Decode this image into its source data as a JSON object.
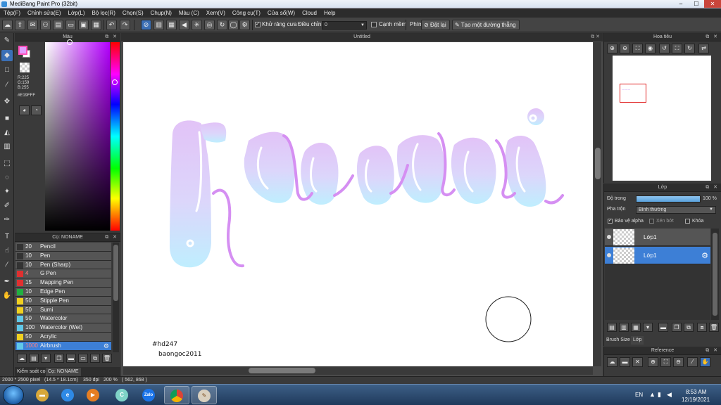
{
  "window": {
    "title": "MediBang Paint Pro (32bit)",
    "min": "–",
    "max": "☐",
    "close": "✕"
  },
  "menu": [
    "Tệp(F)",
    "Chỉnh sửa(E)",
    "Lớp(L)",
    "Bộ lọc(R)",
    "Chọn(S)",
    "Chụp(N)",
    "Màu (C)",
    "Xem(V)",
    "Công cụ(T)",
    "Cửa sổ(W)",
    "Cloud",
    "Help"
  ],
  "toolbar": {
    "antialias_label": "Khử răng cưa",
    "antialias_checked": true,
    "correction_label": "Điều chỉnh",
    "correction_value": "0",
    "edge_label": "Cạnh mềm",
    "edge_checked": false,
    "key_label": "Phím",
    "reset_label": "Đặt lại",
    "straight_line_label": "Tạo một đường thẳng"
  },
  "color_panel": {
    "title": "Màu",
    "r": "R:225",
    "g": "G:159",
    "b": "B:255",
    "hex": "#E19FFF",
    "fg_color": "#e19fff"
  },
  "brush_panel": {
    "title": "Cọ: NONAME",
    "brushes": [
      {
        "size": "20",
        "name": "Pencil",
        "color": "#333333"
      },
      {
        "size": "10",
        "name": "Pen",
        "color": "#333333"
      },
      {
        "size": "10",
        "name": "Pen (Sharp)",
        "color": "#333333"
      },
      {
        "size": "4",
        "name": "G Pen",
        "color": "#e03030"
      },
      {
        "size": "15",
        "name": "Mapping Pen",
        "color": "#e03030"
      },
      {
        "size": "10",
        "name": "Edge Pen",
        "color": "#20b040"
      },
      {
        "size": "50",
        "name": "Stipple Pen",
        "color": "#f0d020"
      },
      {
        "size": "50",
        "name": "Sumi",
        "color": "#f0d020"
      },
      {
        "size": "50",
        "name": "Watercolor",
        "color": "#60c8e8"
      },
      {
        "size": "100",
        "name": "Watercolor (Wet)",
        "color": "#60c8e8"
      },
      {
        "size": "50",
        "name": "Acrylic",
        "color": "#f0d020"
      },
      {
        "size": "1000",
        "name": "Airbrush",
        "color": "#60c8e8"
      }
    ],
    "active_index": 11
  },
  "bottom_tabs": [
    "Kiểm soát cọ",
    "Cọ: NONAME"
  ],
  "canvas": {
    "title": "Untitled",
    "signature_line1": "#hd247",
    "signature_line2": "baongoc2011"
  },
  "navigator": {
    "title": "Hoa tiêu"
  },
  "layer_panel": {
    "title": "Lớp",
    "opacity_label": "Độ trong",
    "opacity_value": "100 %",
    "opacity_fraction": 1.0,
    "blend_label": "Pha trộn",
    "blend_value": "Bình thường",
    "protect_alpha_label": "Bảo vệ alpha",
    "protect_alpha_checked": true,
    "clipping_label": "Xén bớt",
    "lock_label": "Khóa",
    "layers": [
      {
        "name": "Lớp1",
        "active": false
      },
      {
        "name": "Lớp1",
        "active": true
      }
    ],
    "tabs": [
      "Brush Size",
      "Lớp"
    ]
  },
  "reference_panel": {
    "title": "Reference"
  },
  "status": {
    "size": "2000 * 2500 pixel",
    "physical": "(14.5 * 18.1cm)",
    "dpi": "350 dpi",
    "zoom": "200 %",
    "coords": "( 562, 868 )"
  },
  "taskbar": {
    "lang": "EN",
    "time": "8:53 AM",
    "date": "12/19/2021"
  }
}
